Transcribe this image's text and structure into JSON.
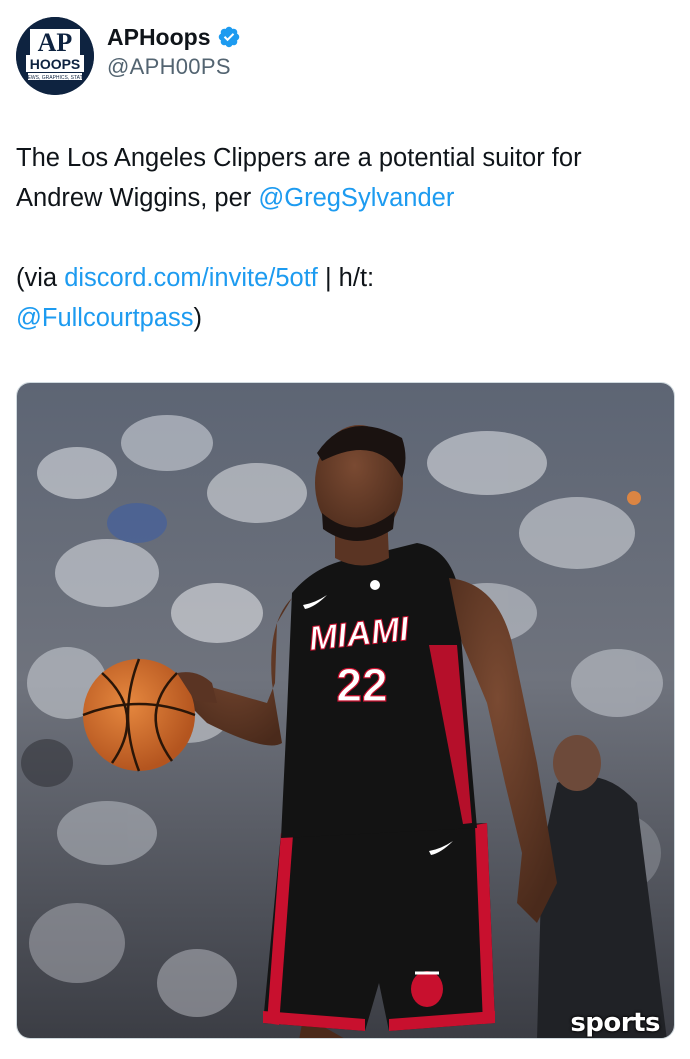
{
  "account": {
    "display_name": "APHoops",
    "handle": "@APH00PS",
    "verified": true,
    "avatar_logo": {
      "top": "AP",
      "middle": "HOOPS",
      "bottom": "NEWS, GRAPHICS, STATS"
    },
    "verified_color": "#1d9bf0"
  },
  "tweet": {
    "line1_text": "The Los Angeles Clippers are a potential suitor for Andrew Wiggins, per ",
    "line1_mention": "@GregSylvander",
    "line2_prefix": "(via ",
    "line2_link": "discord.com/invite/5otf",
    "line2_separator": " |  h/t: ",
    "line2_mention": "@Fullcourtpass",
    "line2_suffix": ")"
  },
  "media": {
    "jersey_team": "MIAMI",
    "jersey_number": "22",
    "watermark": "sports"
  },
  "colors": {
    "text": "#0f1419",
    "secondary": "#536471",
    "link": "#1d9bf0",
    "jersey": "#131313",
    "jersey_trim": "#c8102e"
  }
}
